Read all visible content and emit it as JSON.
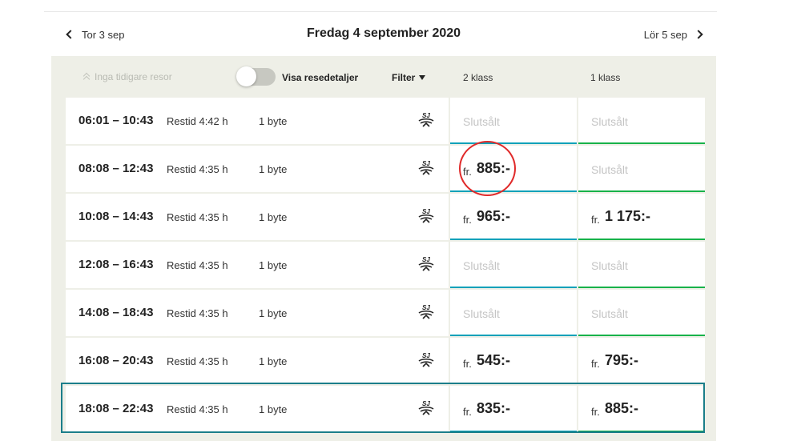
{
  "nav": {
    "prev_label": "Tor 3 sep",
    "title": "Fredag 4 september 2020",
    "next_label": "Lör 5 sep"
  },
  "filterbar": {
    "earlier_label": "Inga tidigare resor",
    "toggle_label": "Visa resedetaljer",
    "toggle_on": false,
    "filter_label": "Filter",
    "col_second": "2 klass",
    "col_first": "1 klass"
  },
  "operator_icon": "sj-logo-icon",
  "colors": {
    "second_class_accent": "#0aa1b9",
    "first_class_accent": "#18b24a",
    "selected_row_border": "#1b7e8a",
    "annotation": "#e02a2a"
  },
  "rows": [
    {
      "times": "06:01 – 10:43",
      "duration": "Restid 4:42 h",
      "changes": "1 byte",
      "second": {
        "sold_out": "Slutsålt"
      },
      "first": {
        "sold_out": "Slutsålt"
      }
    },
    {
      "times": "08:08 – 12:43",
      "duration": "Restid 4:35 h",
      "changes": "1 byte",
      "second": {
        "prefix": "fr.",
        "price": "885:-"
      },
      "first": {
        "sold_out": "Slutsålt"
      }
    },
    {
      "times": "10:08 – 14:43",
      "duration": "Restid 4:35 h",
      "changes": "1 byte",
      "second": {
        "prefix": "fr.",
        "price": "965:-"
      },
      "first": {
        "prefix": "fr.",
        "price": "1 175:-"
      }
    },
    {
      "times": "12:08 – 16:43",
      "duration": "Restid 4:35 h",
      "changes": "1 byte",
      "second": {
        "sold_out": "Slutsålt"
      },
      "first": {
        "sold_out": "Slutsålt"
      }
    },
    {
      "times": "14:08 – 18:43",
      "duration": "Restid 4:35 h",
      "changes": "1 byte",
      "second": {
        "sold_out": "Slutsålt"
      },
      "first": {
        "sold_out": "Slutsålt"
      }
    },
    {
      "times": "16:08 – 20:43",
      "duration": "Restid 4:35 h",
      "changes": "1 byte",
      "second": {
        "prefix": "fr.",
        "price": "545:-"
      },
      "first": {
        "prefix": "fr.",
        "price": "795:-"
      }
    },
    {
      "times": "18:08 – 22:43",
      "duration": "Restid 4:35 h",
      "changes": "1 byte",
      "second": {
        "prefix": "fr.",
        "price": "835:-"
      },
      "first": {
        "prefix": "fr.",
        "price": "885:-"
      }
    }
  ]
}
